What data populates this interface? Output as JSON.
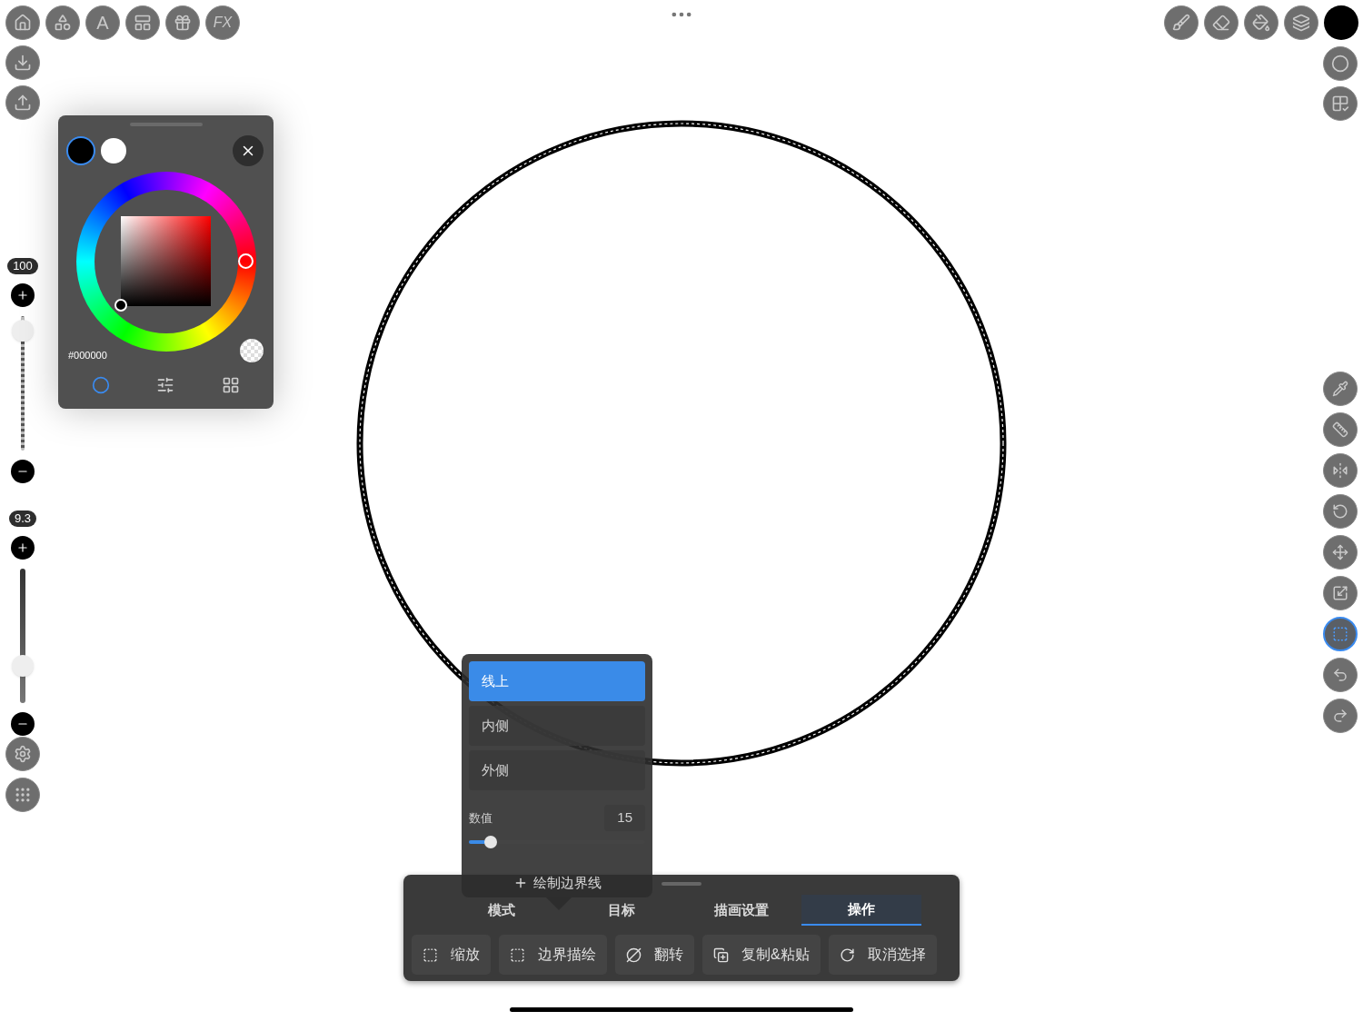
{
  "top_left_tools": {
    "text_tool": "A",
    "fx_tool": "FX"
  },
  "brush_sliders": [
    {
      "reading": "100",
      "level": 0.97,
      "kind": "opacity"
    },
    {
      "reading": "9.3",
      "level": 0.23,
      "kind": "size"
    }
  ],
  "color_panel": {
    "swatches": [
      {
        "color": "#000000",
        "selected": true
      },
      {
        "color": "#ffffff",
        "selected": false
      }
    ],
    "hex": "#000000",
    "tabs": [
      {
        "kind": "wheel",
        "selected": true
      },
      {
        "kind": "sliders",
        "selected": false
      },
      {
        "kind": "palette",
        "selected": false
      }
    ]
  },
  "current_color": {
    "color": "#000000"
  },
  "right_tools": [
    {
      "kind": "eyedropper",
      "selected": false
    },
    {
      "kind": "ruler",
      "selected": false
    },
    {
      "kind": "symmetry",
      "selected": false
    },
    {
      "kind": "rotate",
      "selected": false
    },
    {
      "kind": "move",
      "selected": false
    },
    {
      "kind": "scale",
      "selected": false
    },
    {
      "kind": "select",
      "selected": true
    },
    {
      "kind": "undo",
      "selected": false
    },
    {
      "kind": "redo",
      "selected": false
    }
  ],
  "stroke_popup": {
    "options": [
      {
        "label": "线上",
        "selected": true
      },
      {
        "label": "内侧",
        "selected": false
      },
      {
        "label": "外侧",
        "selected": false
      }
    ],
    "value_label": "数值",
    "value": "15",
    "level": 0.1,
    "add_button": "绘制边界线"
  },
  "bottom_panel": {
    "tabs": [
      {
        "label": "模式",
        "selected": false
      },
      {
        "label": "目标",
        "selected": false
      },
      {
        "label": "描画设置",
        "selected": false
      },
      {
        "label": "操作",
        "selected": true
      }
    ],
    "actions": [
      {
        "label": "缩放",
        "kind": "scale"
      },
      {
        "label": "边界描绘",
        "kind": "border"
      },
      {
        "label": "翻转",
        "kind": "flip"
      },
      {
        "label": "复制&粘贴",
        "kind": "copy"
      },
      {
        "label": "取消选择",
        "kind": "deselect"
      }
    ]
  }
}
